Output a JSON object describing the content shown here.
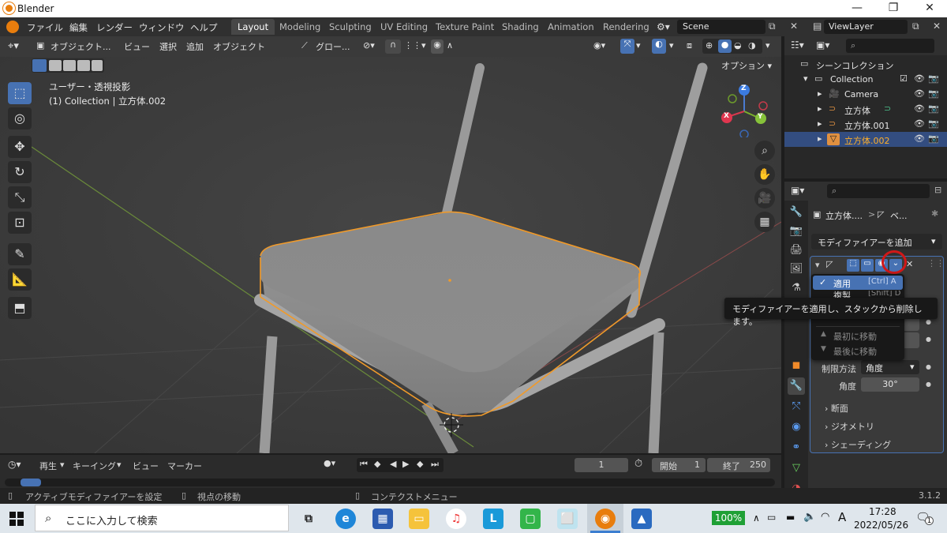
{
  "window": {
    "title": "Blender",
    "minimize": "—",
    "maximize": "❐",
    "close": "✕"
  },
  "menu": {
    "items": [
      "ファイル",
      "編集",
      "レンダー",
      "ウィンドウ",
      "ヘルプ"
    ],
    "workspaces": [
      "Layout",
      "Modeling",
      "Sculpting",
      "UV Editing",
      "Texture Paint",
      "Shading",
      "Animation",
      "Rendering"
    ],
    "active_workspace": "Layout",
    "scene": "Scene",
    "view_layer": "ViewLayer"
  },
  "viewport": {
    "mode": "オブジェクト...",
    "header_menus": [
      "ビュー",
      "選択",
      "追加",
      "オブジェクト"
    ],
    "transform_orientation": "グロー...",
    "options_label": "オプション",
    "overlay_title": "ユーザー・透視投影",
    "overlay_subtitle": "(1) Collection | 立方体.002",
    "gizmo": {
      "z": "Z",
      "y": "Y",
      "x": "X"
    }
  },
  "outliner": {
    "root": "シーンコレクション",
    "collection": "Collection",
    "items": [
      {
        "name": "Camera",
        "selected": false
      },
      {
        "name": "立方体",
        "selected": false
      },
      {
        "name": "立方体.001",
        "selected": false
      },
      {
        "name": "立方体.002",
        "selected": true
      }
    ]
  },
  "properties": {
    "breadcrumb_object": "立方体....",
    "breadcrumb_sep": ">",
    "breadcrumb_modifier": "ベ...",
    "add_modifier": "モディファイアーを追加",
    "limit_method_label": "制限方法",
    "limit_method_value": "角度",
    "angle_label": "角度",
    "angle_value": "30°",
    "sections": [
      "断面",
      "ジオメトリ",
      "シェーディング"
    ]
  },
  "dropdown": {
    "items": [
      {
        "label": "適用",
        "shortcut": "[Ctrl] A",
        "highlighted": true
      },
      {
        "label": "複製",
        "shortcut": "[Shift] D",
        "highlighted": false
      }
    ],
    "move_first": "最初に移動",
    "move_last": "最後に移動"
  },
  "tooltip": "モディファイアーを適用し、スタックから削除します。",
  "timeline": {
    "menus": [
      "再生",
      "キーイング",
      "ビュー",
      "マーカー"
    ],
    "current_frame": "1",
    "start_label": "開始",
    "start_value": "1",
    "end_label": "終了",
    "end_value": "250"
  },
  "status": {
    "left": "アクティブモディファイアーを設定",
    "middle": "視点の移動",
    "right": "コンテクストメニュー",
    "version": "3.1.2"
  },
  "taskbar": {
    "search_placeholder": "ここに入力して検索",
    "battery": "100%",
    "ime": "A",
    "time": "17:28",
    "date": "2022/05/26",
    "notification_count": "1"
  },
  "colors": {
    "accent": "#4772b3",
    "selected_text": "#ffaf29",
    "selection_outline": "#f09a2a",
    "annotation_circle": "#d01818"
  }
}
